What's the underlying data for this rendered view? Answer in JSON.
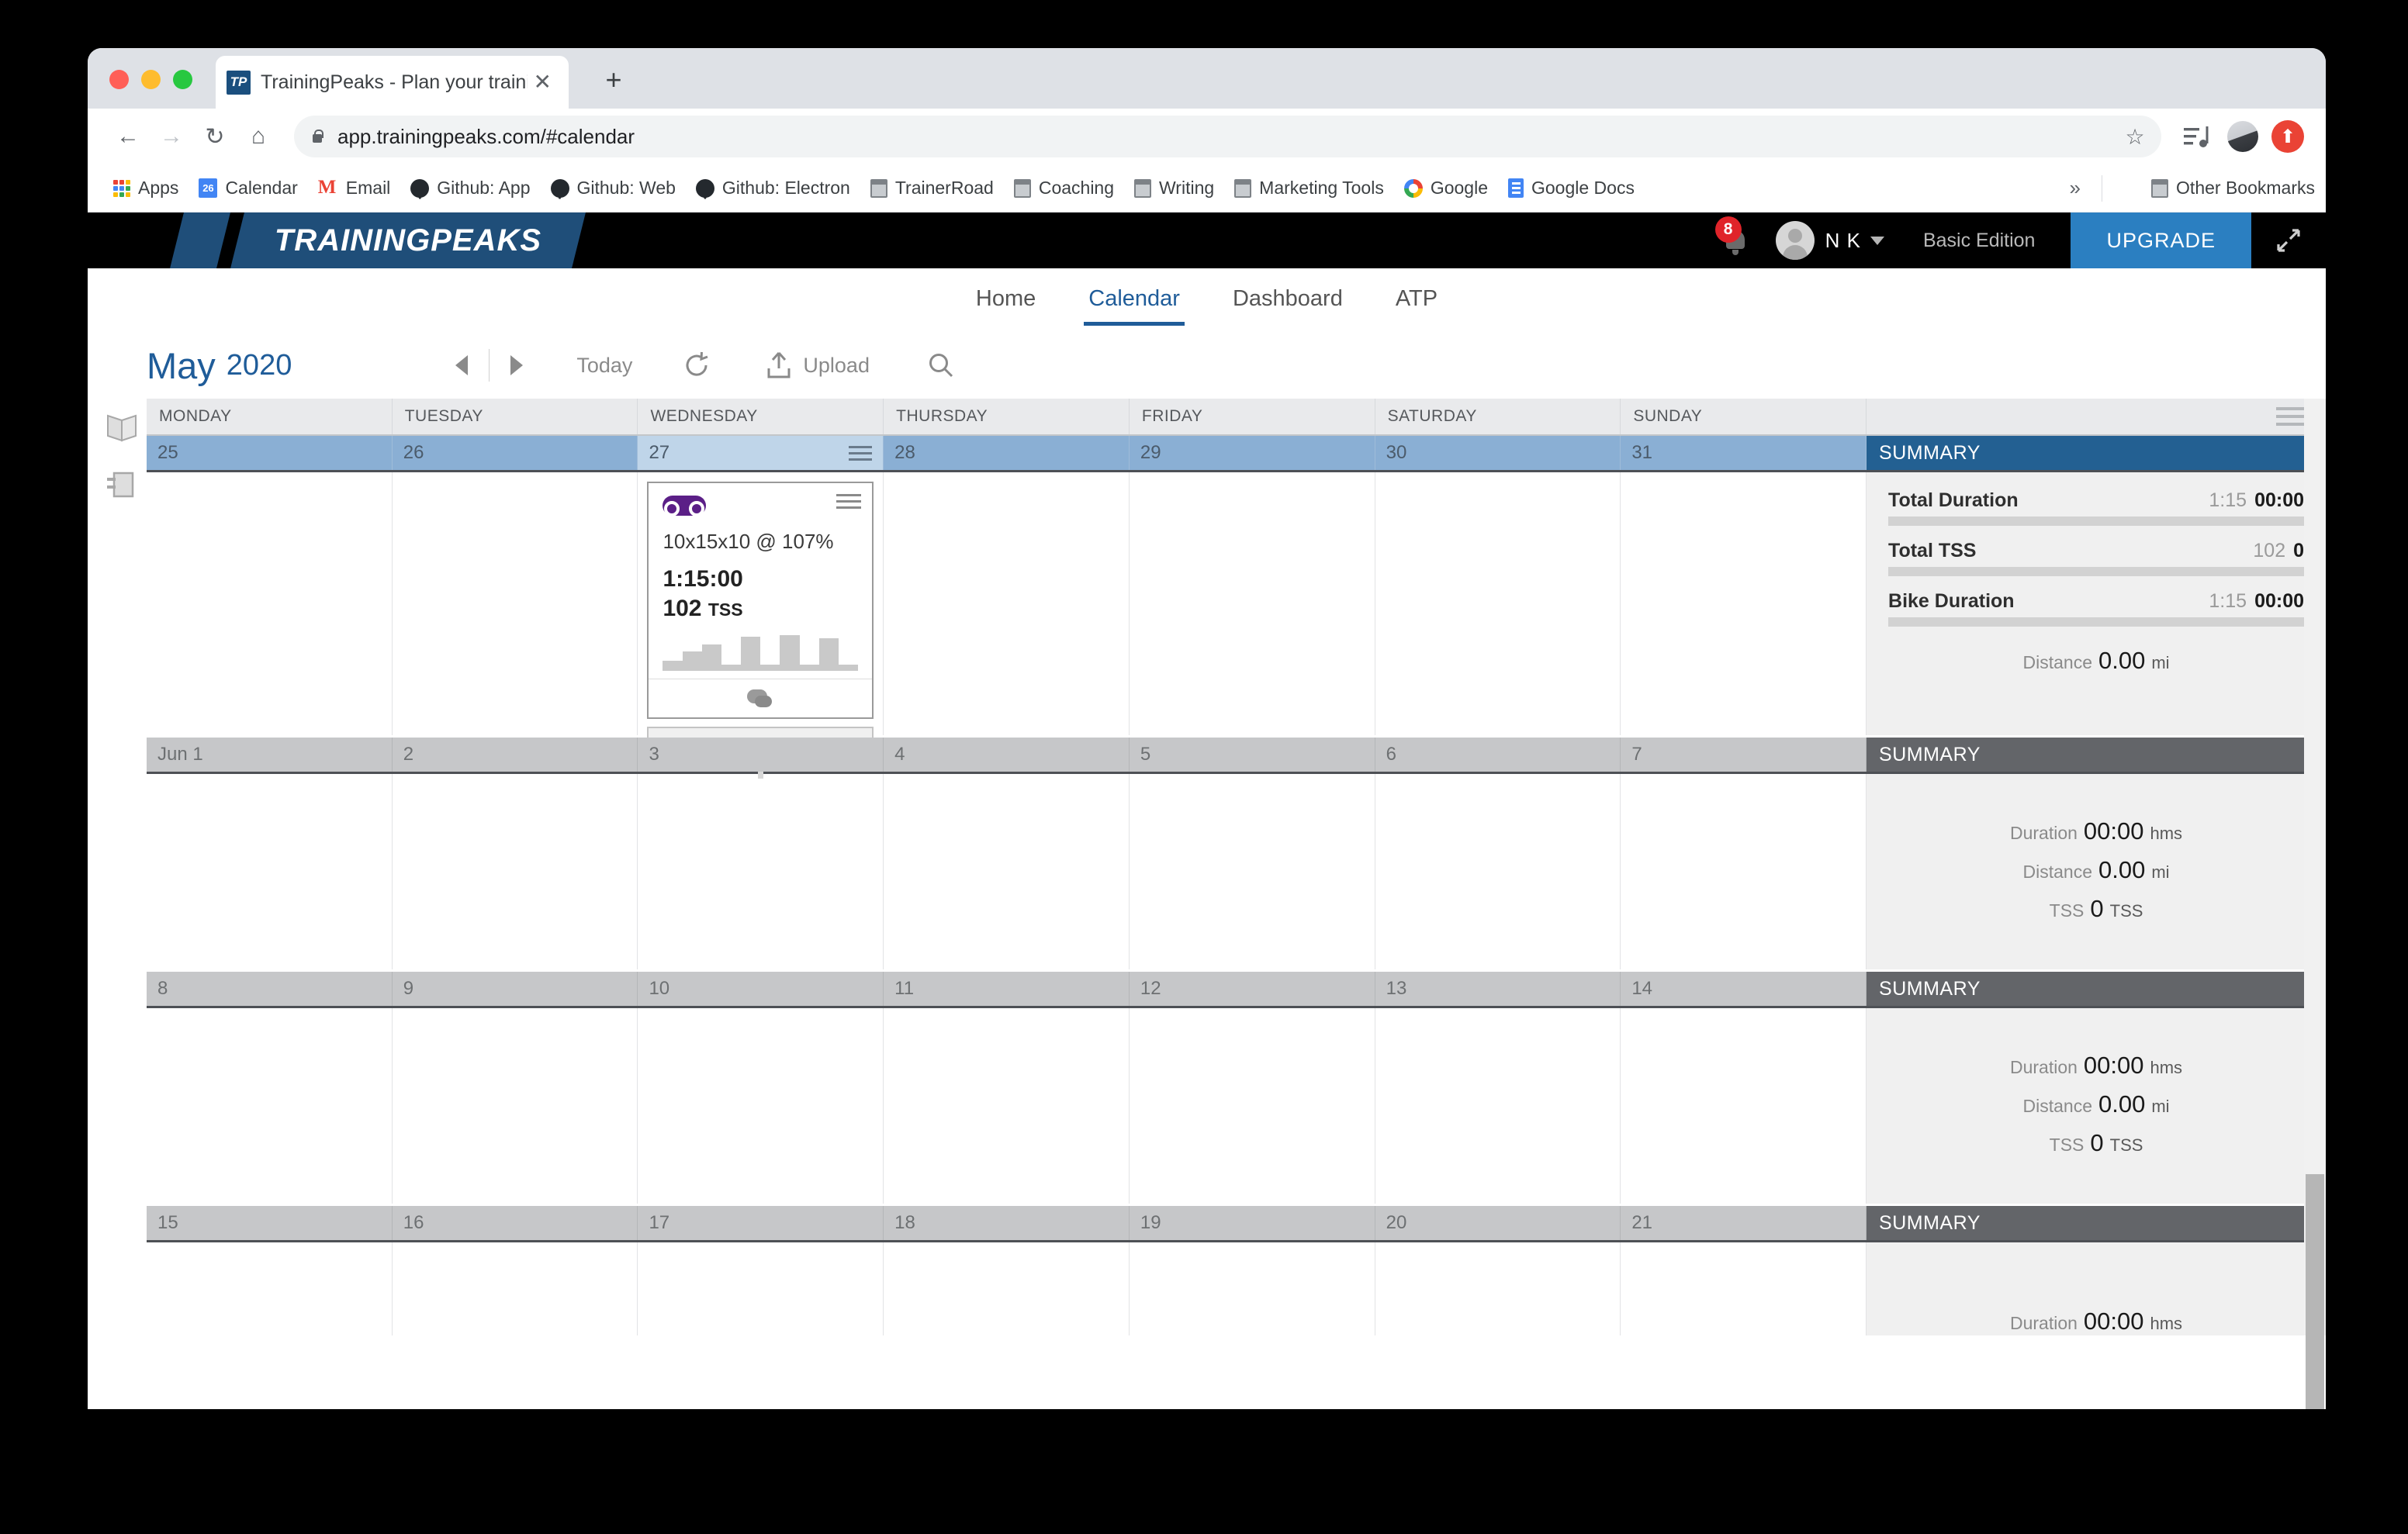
{
  "browser": {
    "tab": {
      "favicon_text": "TP",
      "title": "TrainingPeaks - Plan your traini",
      "close_icon": "close-icon"
    },
    "new_tab_label": "+",
    "nav": {
      "back": "←",
      "forward": "→",
      "reload": "↻",
      "home": "⌂"
    },
    "omnibox": {
      "url": "app.trainingpeaks.com/#calendar",
      "lock_icon": "lock-icon",
      "star_icon": "star-icon"
    },
    "toolbar_icons": [
      "reading-list-icon",
      "profile-avatar",
      "update-icon"
    ],
    "bookmarks": [
      {
        "label": "Apps",
        "icon": "apps-grid-icon"
      },
      {
        "label": "Calendar",
        "icon": "calendar-icon",
        "icon_text": "26"
      },
      {
        "label": "Email",
        "icon": "gmail-icon",
        "icon_text": "M"
      },
      {
        "label": "Github: App",
        "icon": "github-icon"
      },
      {
        "label": "Github: Web",
        "icon": "github-icon"
      },
      {
        "label": "Github: Electron",
        "icon": "github-icon"
      },
      {
        "label": "TrainerRoad",
        "icon": "folder-icon"
      },
      {
        "label": "Coaching",
        "icon": "folder-icon"
      },
      {
        "label": "Writing",
        "icon": "folder-icon"
      },
      {
        "label": "Marketing Tools",
        "icon": "folder-icon"
      },
      {
        "label": "Google",
        "icon": "google-icon"
      },
      {
        "label": "Google Docs",
        "icon": "google-docs-icon"
      }
    ],
    "bookmarks_overflow": "»",
    "other_bookmarks": {
      "label": "Other Bookmarks",
      "icon": "folder-icon"
    }
  },
  "app_header": {
    "logo_text": "TRAININGPEAKS",
    "notification_count": "8",
    "user_name": "N K",
    "edition": "Basic Edition",
    "upgrade_label": "UPGRADE",
    "expand_icon": "expand-arrows-icon"
  },
  "nav_tabs": [
    {
      "label": "Home",
      "active": false
    },
    {
      "label": "Calendar",
      "active": true
    },
    {
      "label": "Dashboard",
      "active": false
    },
    {
      "label": "ATP",
      "active": false
    }
  ],
  "calendar_toolbar": {
    "month": "May",
    "year": "2020",
    "prev_label": "previous-month",
    "next_label": "next-month",
    "today_label": "Today",
    "refresh_icon": "refresh-icon",
    "upload_label": "Upload",
    "search_icon": "search-icon"
  },
  "sidebar_icons": [
    {
      "name": "library-book-icon"
    },
    {
      "name": "panel-toggle-icon"
    }
  ],
  "day_headers": [
    "MONDAY",
    "TUESDAY",
    "WEDNESDAY",
    "THURSDAY",
    "FRIDAY",
    "SATURDAY",
    "SUNDAY"
  ],
  "grid_menu_icon": "grid-options-icon",
  "weeks": [
    {
      "style": "blue",
      "days": [
        "25",
        "26",
        "27",
        "28",
        "29",
        "30",
        "31"
      ],
      "today_index": 2,
      "summary_label": "SUMMARY",
      "summary_type": "detailed",
      "summary": {
        "rows": [
          {
            "label": "Total Duration",
            "planned": "1:15",
            "actual": "00:00"
          },
          {
            "label": "Total TSS",
            "planned": "102",
            "actual": "0"
          },
          {
            "label": "Bike Duration",
            "planned": "1:15",
            "actual": "00:00"
          }
        ],
        "center_rows": [
          {
            "label": "Distance",
            "value": "0.00",
            "unit": "mi"
          }
        ]
      }
    },
    {
      "style": "gray",
      "days": [
        "Jun 1",
        "2",
        "3",
        "4",
        "5",
        "6",
        "7"
      ],
      "today_index": -1,
      "summary_label": "SUMMARY",
      "summary_type": "simple",
      "summary": {
        "center_rows": [
          {
            "label": "Duration",
            "value": "00:00",
            "unit": "hms"
          },
          {
            "label": "Distance",
            "value": "0.00",
            "unit": "mi"
          },
          {
            "label": "TSS",
            "value": "0",
            "unit": "TSS"
          }
        ]
      }
    },
    {
      "style": "gray",
      "days": [
        "8",
        "9",
        "10",
        "11",
        "12",
        "13",
        "14"
      ],
      "today_index": -1,
      "summary_label": "SUMMARY",
      "summary_type": "simple",
      "summary": {
        "center_rows": [
          {
            "label": "Duration",
            "value": "00:00",
            "unit": "hms"
          },
          {
            "label": "Distance",
            "value": "0.00",
            "unit": "mi"
          },
          {
            "label": "TSS",
            "value": "0",
            "unit": "TSS"
          }
        ]
      }
    },
    {
      "style": "gray",
      "days": [
        "15",
        "16",
        "17",
        "18",
        "19",
        "20",
        "21"
      ],
      "today_index": -1,
      "summary_label": "SUMMARY",
      "summary_type": "simple",
      "summary": {
        "center_rows": [
          {
            "label": "Duration",
            "value": "00:00",
            "unit": "hms"
          }
        ]
      }
    }
  ],
  "workout": {
    "day_index": 2,
    "week_index": 0,
    "sport_icon": "bike-chain-icon",
    "sport_color": "#5b1f87",
    "menu_icon": "workout-menu-icon",
    "title": "10x15x10 @ 107%",
    "duration": "1:15:00",
    "tss_value": "102",
    "tss_unit": "TSS",
    "comment_icon": "comment-icon",
    "chart_bars": [
      28,
      55,
      75,
      18,
      95,
      18,
      100,
      18,
      92,
      18
    ],
    "add_label": "add-workout"
  },
  "colors": {
    "accent_blue": "#1f5c99",
    "summary_blue": "#236092",
    "summary_gray": "#636569",
    "week_blue": "#8aafd4",
    "week_today": "#bfd5e9",
    "week_gray": "#c6c7c9",
    "upgrade": "#2b7fc1",
    "badge_red": "#e0242a"
  }
}
